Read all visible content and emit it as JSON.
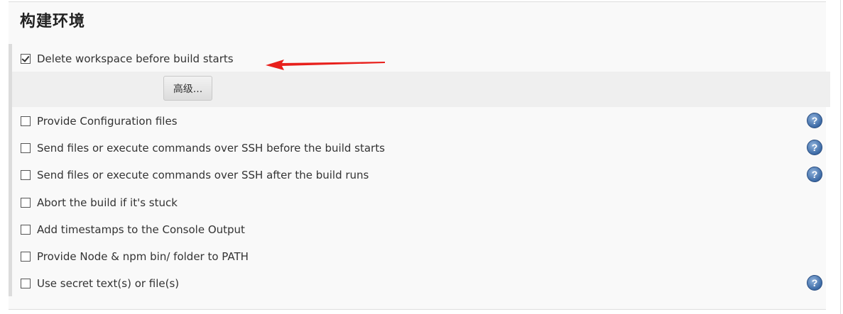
{
  "section": {
    "title": "构建环境"
  },
  "options": [
    {
      "label": "Delete workspace before build starts",
      "checked": true,
      "help": false
    },
    {
      "label": "Provide Configuration files",
      "checked": false,
      "help": true
    },
    {
      "label": "Send files or execute commands over SSH before the build starts",
      "checked": false,
      "help": true
    },
    {
      "label": "Send files or execute commands over SSH after the build runs",
      "checked": false,
      "help": true
    },
    {
      "label": "Abort the build if it's stuck",
      "checked": false,
      "help": false
    },
    {
      "label": "Add timestamps to the Console Output",
      "checked": false,
      "help": false
    },
    {
      "label": "Provide Node & npm bin/ folder to PATH",
      "checked": false,
      "help": false
    },
    {
      "label": "Use secret text(s) or file(s)",
      "checked": false,
      "help": true
    }
  ],
  "advanced_button": {
    "label": "高级..."
  },
  "help_icon": {
    "glyph": "?",
    "color": "#3c6aa5"
  },
  "annotation": {
    "color": "#e8201c"
  }
}
